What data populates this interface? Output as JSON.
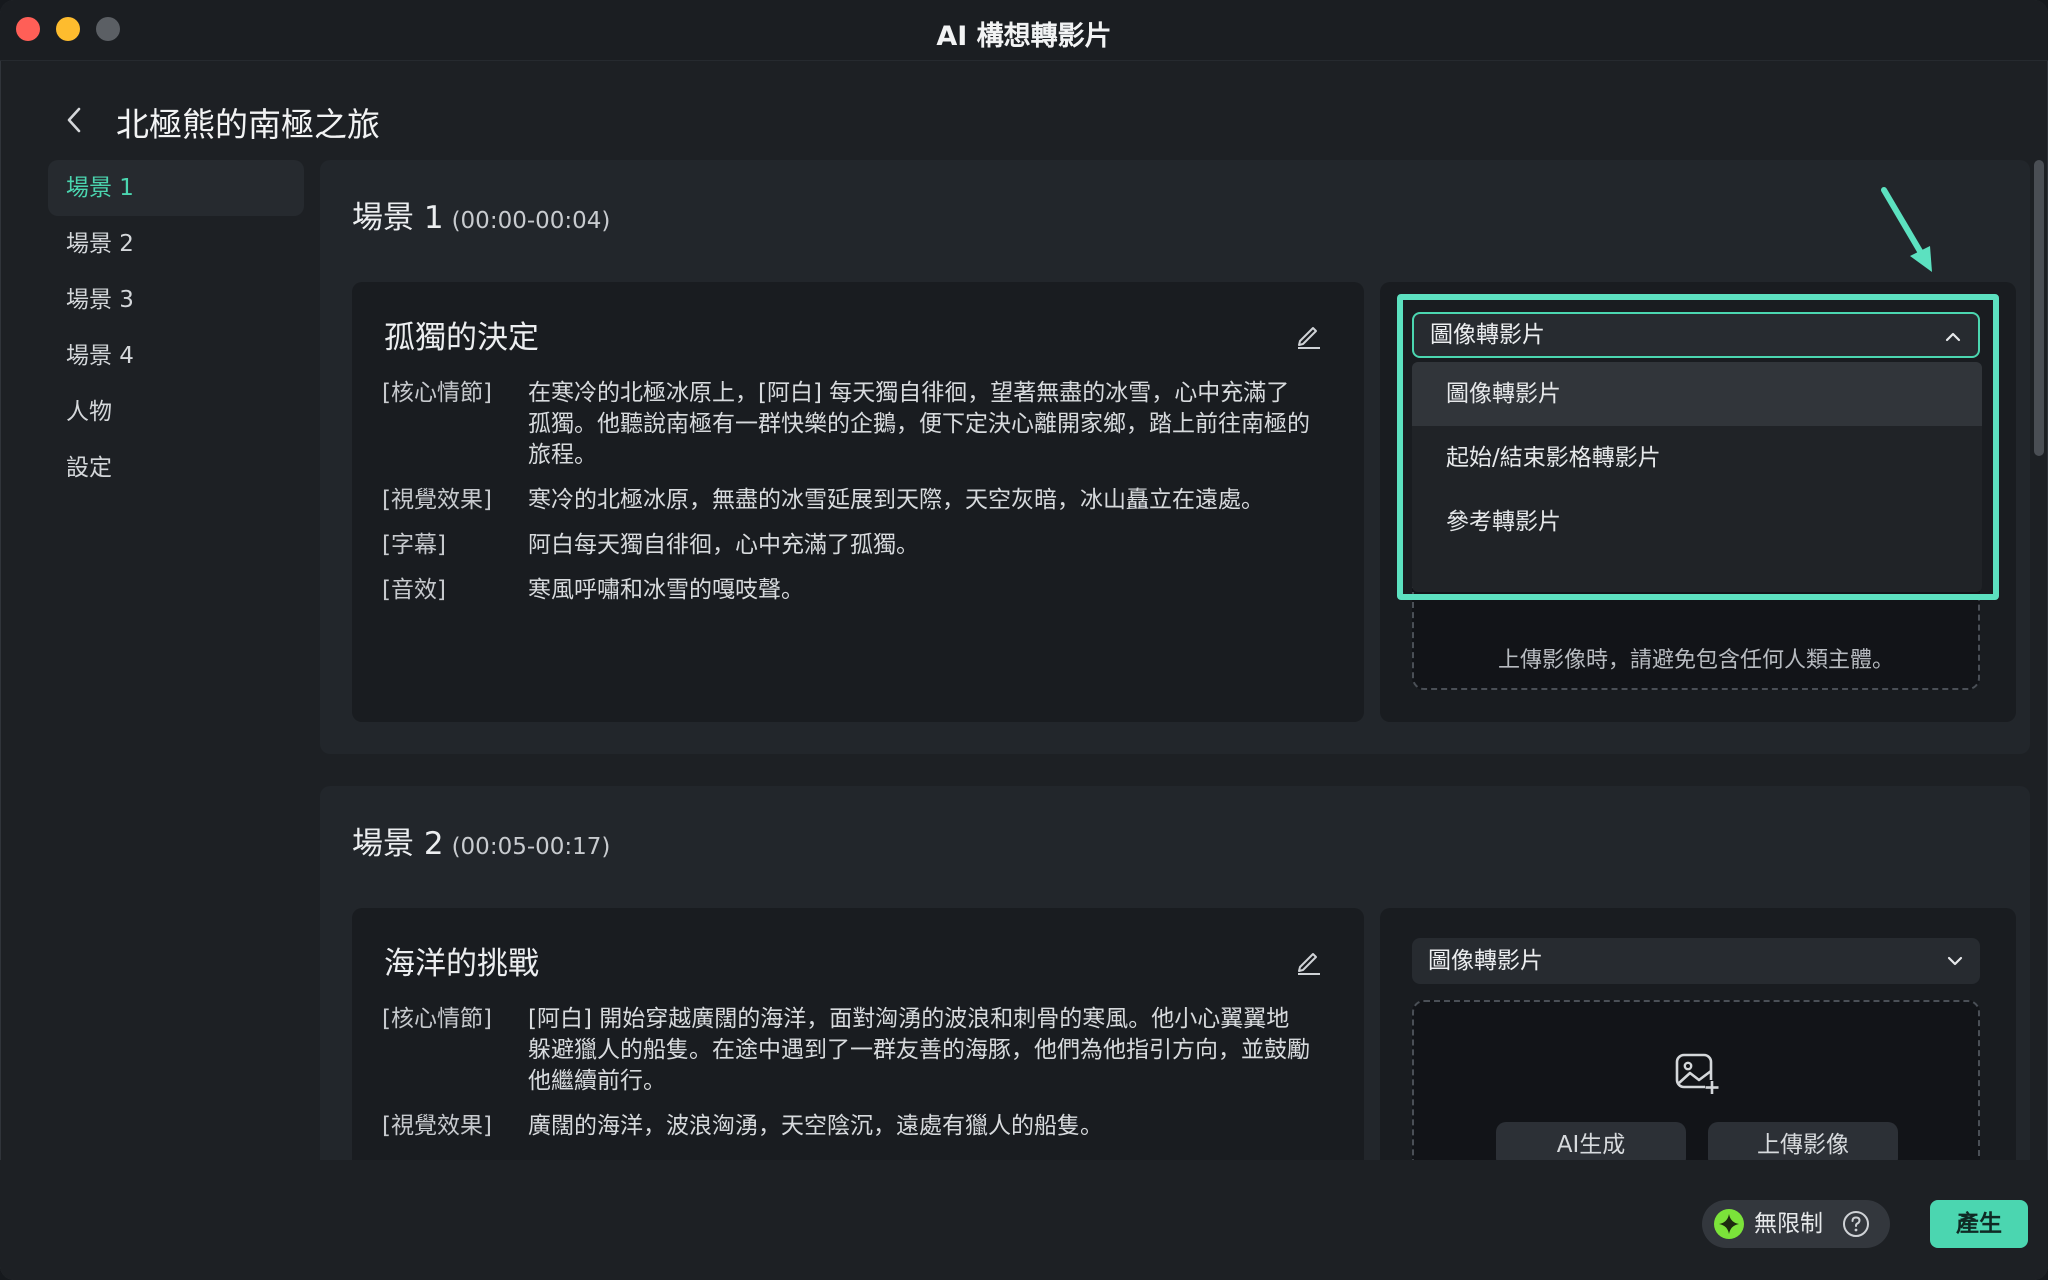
{
  "window": {
    "title": "AI 構想轉影片"
  },
  "project": {
    "title": "北極熊的南極之旅"
  },
  "sidebar": {
    "items": [
      {
        "label": "場景 1"
      },
      {
        "label": "場景 2"
      },
      {
        "label": "場景 3"
      },
      {
        "label": "場景 4"
      },
      {
        "label": "人物"
      },
      {
        "label": "設定"
      }
    ],
    "active_index": 0
  },
  "scenes": [
    {
      "name": "場景 1",
      "time": "(00:00-00:04)",
      "story_title": "孤獨的決定",
      "rows": [
        {
          "label": "[核心情節]",
          "value": "在寒冷的北極冰原上，[阿白] 每天獨自徘徊，望著無盡的冰雪，心中充滿了孤獨。他聽說南極有一群快樂的企鵝，便下定決心離開家鄉，踏上前往南極的旅程。"
        },
        {
          "label": "[視覺效果]",
          "value": "寒冷的北極冰原，無盡的冰雪延展到天際，天空灰暗，冰山矗立在遠處。"
        },
        {
          "label": "[字幕]",
          "value": "阿白每天獨自徘徊，心中充滿了孤獨。"
        },
        {
          "label": "[音效]",
          "value": "寒風呼嘯和冰雪的嘎吱聲。"
        }
      ],
      "mode_select": "圖像轉影片",
      "upload_hint": "上傳影像時，請避免包含任何人類主體。"
    },
    {
      "name": "場景 2",
      "time": "(00:05-00:17)",
      "story_title": "海洋的挑戰",
      "rows": [
        {
          "label": "[核心情節]",
          "value": "[阿白] 開始穿越廣闊的海洋，面對洶湧的波浪和刺骨的寒風。他小心翼翼地躲避獵人的船隻。在途中遇到了一群友善的海豚，他們為他指引方向，並鼓勵他繼續前行。"
        },
        {
          "label": "[視覺效果]",
          "value": "廣闊的海洋，波浪洶湧，天空陰沉，遠處有獵人的船隻。"
        }
      ],
      "mode_select": "圖像轉影片",
      "ai_generate_label": "AI生成",
      "upload_label": "上傳影像"
    }
  ],
  "dropdown": {
    "options": [
      "圖像轉影片",
      "起始/結束影格轉影片",
      "參考轉影片"
    ],
    "selected_index": 0
  },
  "footer": {
    "unlimited_label": "無限制",
    "generate_label": "產生"
  },
  "colors": {
    "accent": "#4bd6b0",
    "highlight": "#5ce1c0"
  }
}
